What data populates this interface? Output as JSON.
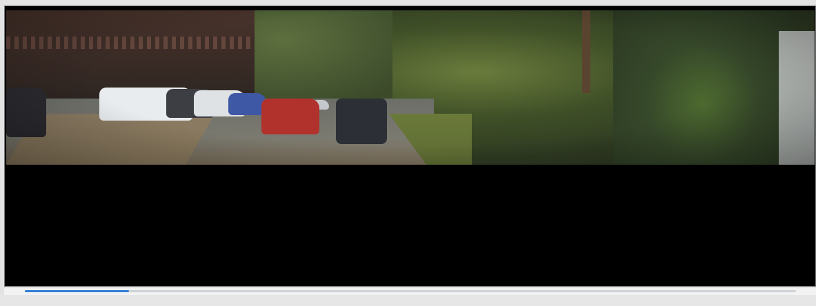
{
  "video": {
    "overlay_top_line1": "",
    "overlay_top_line2": "",
    "overlay_bottom_speed": "",
    "overlay_bottom_text": "",
    "overlay_br_line1": "",
    "overlay_br_line2": "",
    "overlay_br_line3": ""
  },
  "controls": {
    "current_time": "",
    "duration": "",
    "progress_fraction": 0.135,
    "accent_color": "#2f7fd6"
  },
  "icons": {
    "seek": "seek-bar"
  }
}
